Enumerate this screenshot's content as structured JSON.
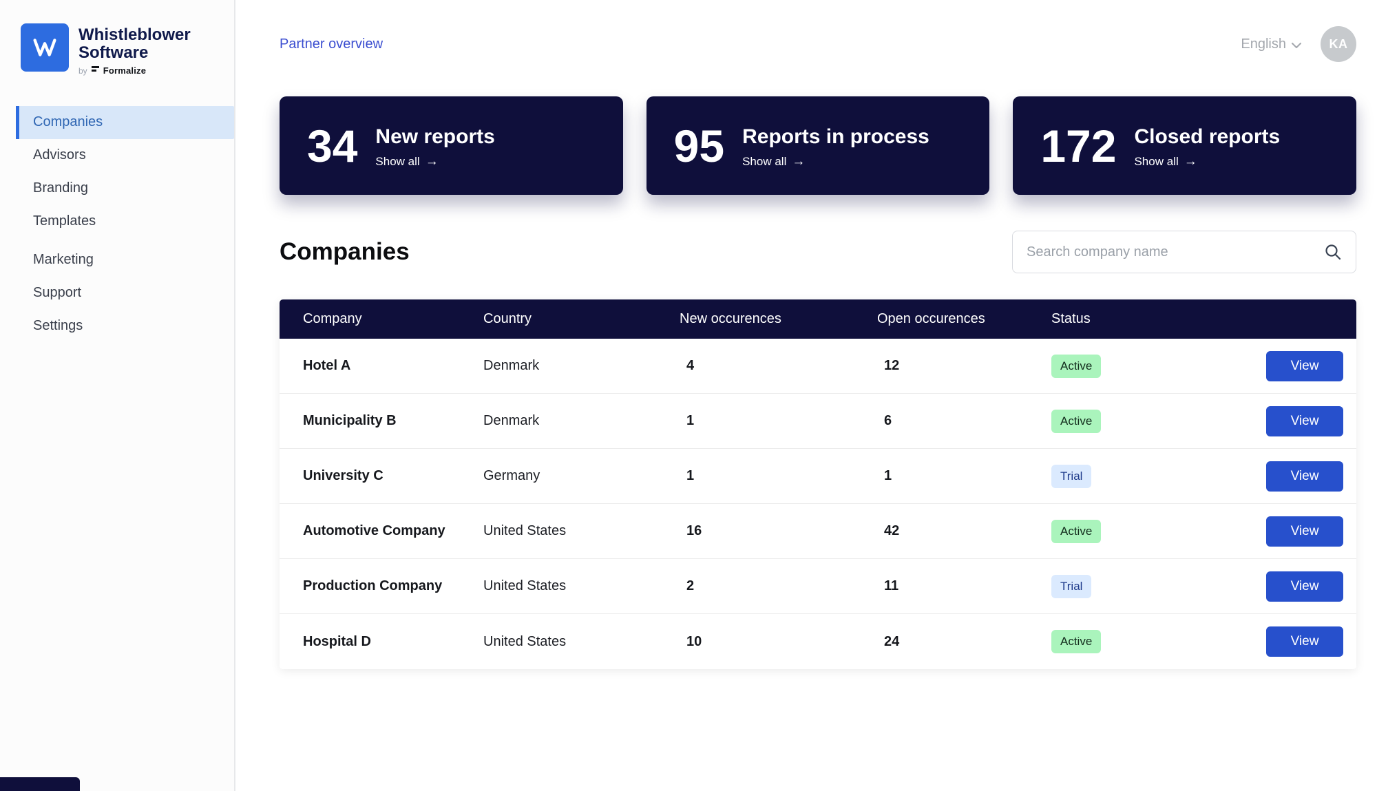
{
  "brand": {
    "name_line1": "Whistleblower",
    "name_line2": "Software",
    "byline_prefix": "by",
    "byline_brand": "Formalize"
  },
  "sidebar": {
    "items": [
      {
        "label": "Companies",
        "active": true
      },
      {
        "label": "Advisors",
        "active": false
      },
      {
        "label": "Branding",
        "active": false
      },
      {
        "label": "Templates",
        "active": false
      },
      {
        "label": "Marketing",
        "active": false
      },
      {
        "label": "Support",
        "active": false
      },
      {
        "label": "Settings",
        "active": false
      }
    ]
  },
  "header": {
    "breadcrumb": "Partner overview",
    "language": "English",
    "avatar_initials": "KA"
  },
  "stat_cards": [
    {
      "value": "34",
      "label": "New reports",
      "link": "Show all"
    },
    {
      "value": "95",
      "label": "Reports in process",
      "link": "Show all"
    },
    {
      "value": "172",
      "label": "Closed reports",
      "link": "Show all"
    }
  ],
  "companies_section": {
    "title": "Companies",
    "search_placeholder": "Search company name"
  },
  "table": {
    "headers": [
      "Company",
      "Country",
      "New occurences",
      "Open occurences",
      "Status"
    ],
    "rows": [
      {
        "company": "Hotel A",
        "country": "Denmark",
        "new_occurences": "4",
        "open_occurences": "12",
        "status": "Active",
        "action": "View"
      },
      {
        "company": "Municipality B",
        "country": "Denmark",
        "new_occurences": "1",
        "open_occurences": "6",
        "status": "Active",
        "action": "View"
      },
      {
        "company": "University C",
        "country": "Germany",
        "new_occurences": "1",
        "open_occurences": "1",
        "status": "Trial",
        "action": "View"
      },
      {
        "company": "Automotive Company",
        "country": "United States",
        "new_occurences": "16",
        "open_occurences": "42",
        "status": "Active",
        "action": "View"
      },
      {
        "company": "Production Company",
        "country": "United States",
        "new_occurences": "2",
        "open_occurences": "11",
        "status": "Trial",
        "action": "View"
      },
      {
        "company": "Hospital D",
        "country": "United States",
        "new_occurences": "10",
        "open_occurences": "24",
        "status": "Active",
        "action": "View"
      }
    ]
  },
  "icons": {
    "arrow_right": "→"
  },
  "colors": {
    "navy": "#0f0f3b",
    "accent_blue": "#2750cc",
    "active_badge_bg": "#aaf4bc",
    "trial_badge_bg": "#dbeafe",
    "sidebar_active_bg": "#d8e7f9"
  }
}
